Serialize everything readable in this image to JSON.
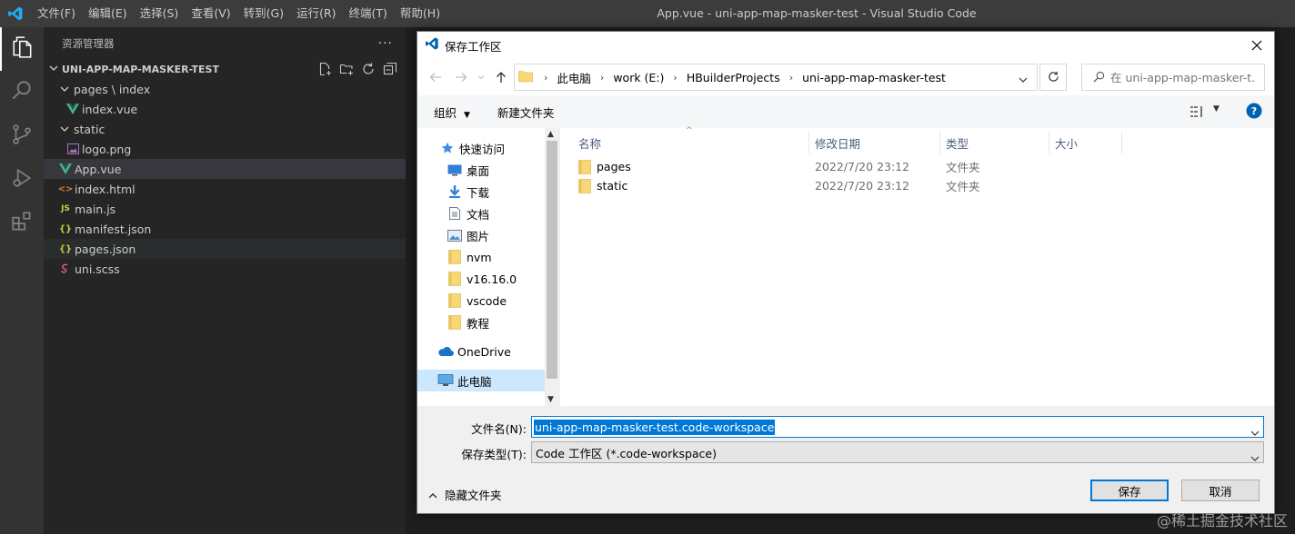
{
  "titlebar": {
    "menu": [
      "文件(F)",
      "编辑(E)",
      "选择(S)",
      "查看(V)",
      "转到(G)",
      "运行(R)",
      "终端(T)",
      "帮助(H)"
    ],
    "window_title": "App.vue - uni-app-map-masker-test - Visual Studio Code"
  },
  "sidebar": {
    "title": "资源管理器",
    "more": "···",
    "project": "UNI-APP-MAP-MASKER-TEST",
    "tree": [
      {
        "label": "pages \\ index",
        "type": "folder"
      },
      {
        "label": "index.vue",
        "type": "vue"
      },
      {
        "label": "static",
        "type": "folder"
      },
      {
        "label": "logo.png",
        "type": "image"
      },
      {
        "label": "App.vue",
        "type": "vue"
      },
      {
        "label": "index.html",
        "type": "html",
        "icon_text": "<>"
      },
      {
        "label": "main.js",
        "type": "js",
        "icon_text": "JS"
      },
      {
        "label": "manifest.json",
        "type": "json",
        "icon_text": "{}"
      },
      {
        "label": "pages.json",
        "type": "json",
        "icon_text": "{}"
      },
      {
        "label": "uni.scss",
        "type": "scss"
      }
    ]
  },
  "dialog": {
    "title": "保存工作区",
    "breadcrumbs": [
      "此电脑",
      "work (E:)",
      "HBuilderProjects",
      "uni-app-map-masker-test"
    ],
    "search_placeholder": "在 uni-app-map-masker-t...",
    "organize": "组织",
    "new_folder": "新建文件夹",
    "nav": {
      "quick_access": "快速访问",
      "items": [
        {
          "label": "桌面",
          "pinned": true
        },
        {
          "label": "下载",
          "pinned": true
        },
        {
          "label": "文档",
          "pinned": true
        },
        {
          "label": "图片",
          "pinned": true
        },
        {
          "label": "nvm",
          "pinned": false
        },
        {
          "label": "v16.16.0",
          "pinned": false
        },
        {
          "label": "vscode",
          "pinned": false
        },
        {
          "label": "教程",
          "pinned": false
        }
      ],
      "onedrive": "OneDrive",
      "this_pc": "此电脑"
    },
    "columns": [
      "名称",
      "修改日期",
      "类型",
      "大小"
    ],
    "files": [
      {
        "name": "pages",
        "modified": "2022/7/20 23:12",
        "type": "文件夹",
        "size": ""
      },
      {
        "name": "static",
        "modified": "2022/7/20 23:12",
        "type": "文件夹",
        "size": ""
      }
    ],
    "filename_label": "文件名(N):",
    "filename_value": "uni-app-map-masker-test.code-workspace",
    "filetype_label": "保存类型(T):",
    "filetype_value": "Code 工作区 (*.code-workspace)",
    "hide_folders": "隐藏文件夹",
    "save": "保存",
    "cancel": "取消"
  },
  "watermark": "@稀土掘金技术社区",
  "colors": {
    "accent": "#0078d7",
    "vscode_bg": "#1e1e1e",
    "sidebar_bg": "#252526",
    "folder": "#f8d775"
  }
}
